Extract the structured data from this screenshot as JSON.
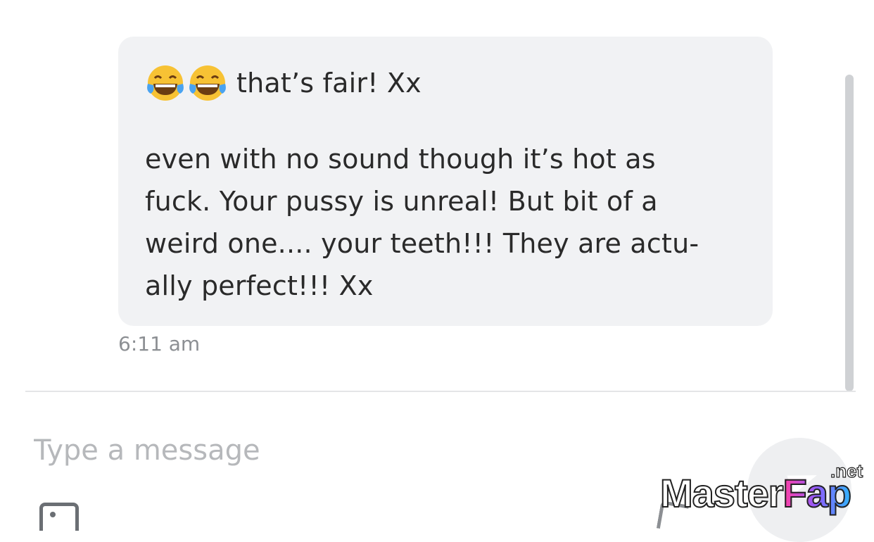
{
  "message": {
    "emoji_count": 2,
    "emoji_icon": "face-with-tears-of-joy-icon",
    "line1": "that’s fair! Xx",
    "body": "even with no sound though it’s hot as\nfuck. Your pussy is unreal! But bit of a\nweird one.... your teeth!!! They are actu-\nally perfect!!! Xx",
    "timestamp": "6:11 am",
    "bubble_color": "#f1f2f4"
  },
  "composer": {
    "placeholder": "Type a message",
    "attach_icon": "image-icon",
    "send_icon": "send-icon",
    "tag_icon": "price-tag-icon"
  },
  "watermark": {
    "main": "Master",
    "accent": "Fap",
    "tld": ".net"
  }
}
